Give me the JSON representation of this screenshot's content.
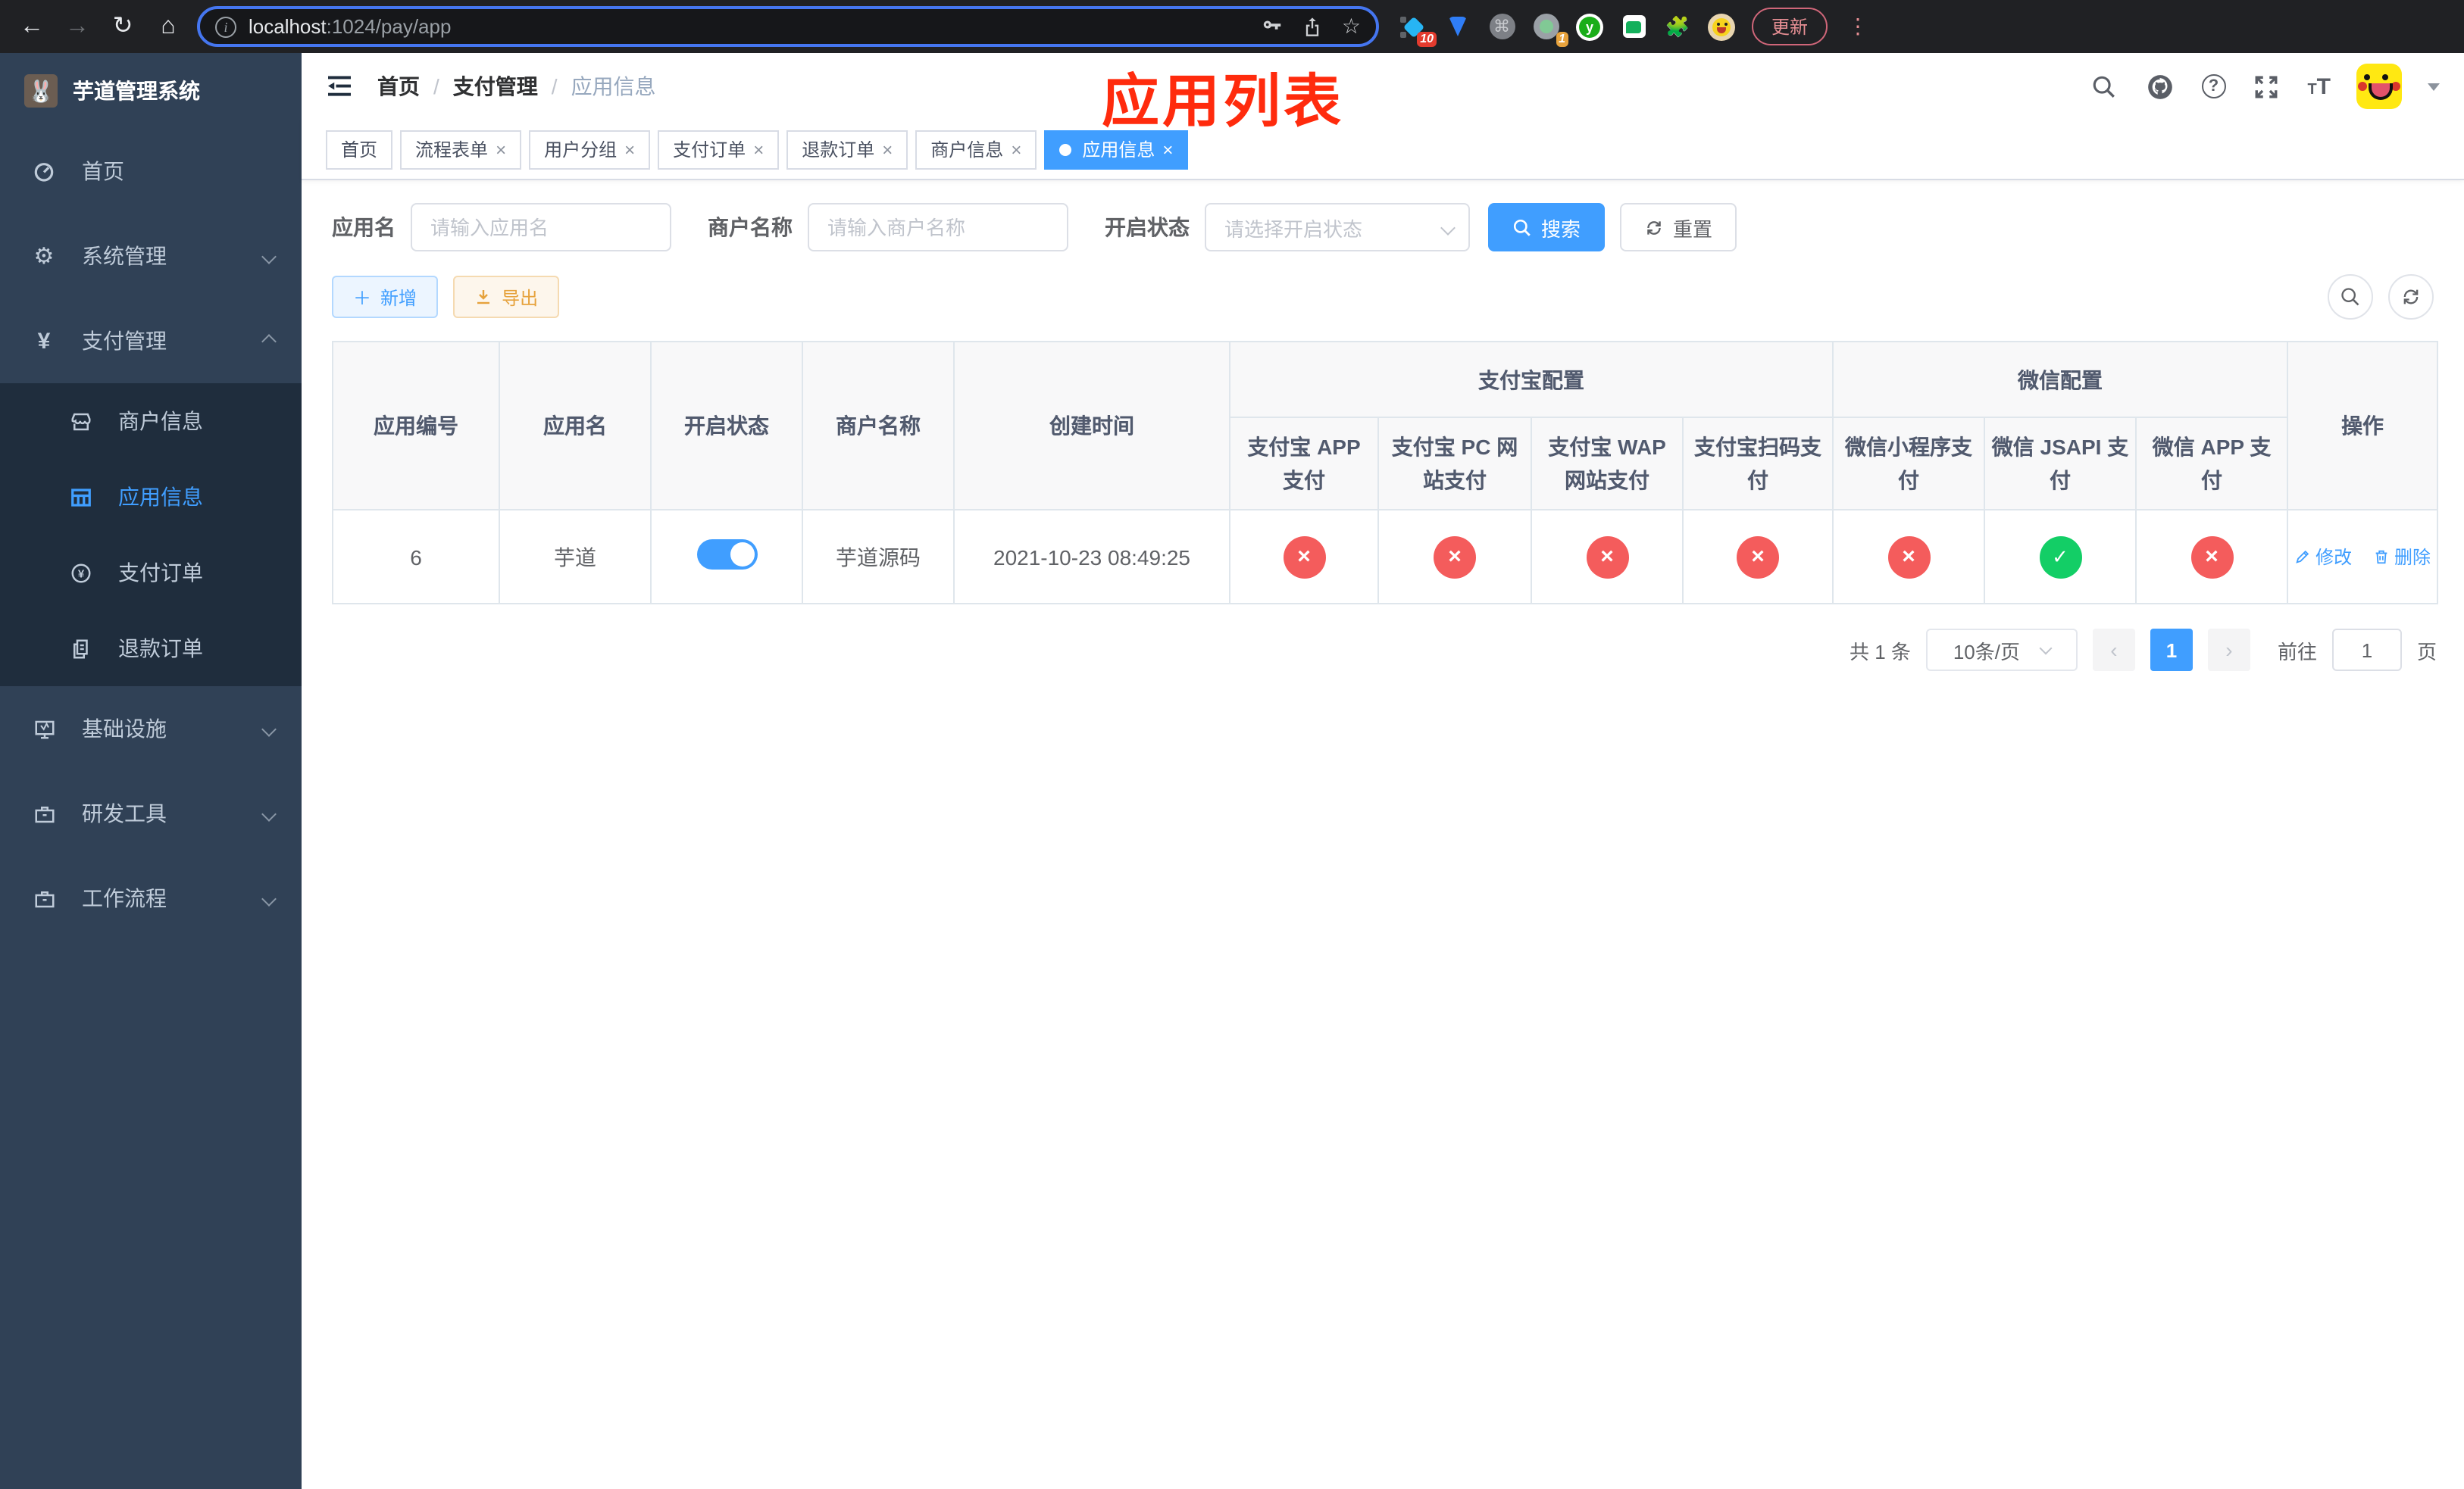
{
  "browser": {
    "url_host": "localhost",
    "url_path": ":1024/pay/app",
    "update_label": "更新",
    "ext_badge_red": "10",
    "ext_badge_orange": "1"
  },
  "sidebar": {
    "title": "芋道管理系统",
    "menu": [
      {
        "label": "首页"
      },
      {
        "label": "系统管理"
      },
      {
        "label": "支付管理"
      },
      {
        "label": "基础设施"
      },
      {
        "label": "研发工具"
      },
      {
        "label": "工作流程"
      }
    ],
    "submenu": [
      {
        "label": "商户信息"
      },
      {
        "label": "应用信息"
      },
      {
        "label": "支付订单"
      },
      {
        "label": "退款订单"
      }
    ]
  },
  "header": {
    "breadcrumb": [
      {
        "label": "首页"
      },
      {
        "label": "支付管理"
      },
      {
        "label": "应用信息"
      }
    ],
    "annotation": "应用列表"
  },
  "tabs": [
    {
      "label": "首页"
    },
    {
      "label": "流程表单"
    },
    {
      "label": "用户分组"
    },
    {
      "label": "支付订单"
    },
    {
      "label": "退款订单"
    },
    {
      "label": "商户信息"
    },
    {
      "label": "应用信息"
    }
  ],
  "filters": {
    "app_name_label": "应用名",
    "app_name_placeholder": "请输入应用名",
    "merchant_label": "商户名称",
    "merchant_placeholder": "请输入商户名称",
    "status_label": "开启状态",
    "status_placeholder": "请选择开启状态",
    "search_label": "搜索",
    "reset_label": "重置"
  },
  "toolbar": {
    "add_label": "新增",
    "export_label": "导出"
  },
  "table": {
    "headers": {
      "app_id": "应用编号",
      "app_name": "应用名",
      "status": "开启状态",
      "merchant": "商户名称",
      "created": "创建时间",
      "alipay_group": "支付宝配置",
      "wechat_group": "微信配置",
      "alipay_app": "支付宝 APP 支付",
      "alipay_pc": "支付宝 PC 网站支付",
      "alipay_wap": "支付宝 WAP 网站支付",
      "alipay_qr": "支付宝扫码支付",
      "wx_lite": "微信小程序支付",
      "wx_jsapi": "微信 JSAPI 支付",
      "wx_app": "微信 APP 支付",
      "actions": "操作"
    },
    "rows": [
      {
        "app_id": "6",
        "app_name": "芋道",
        "status_on": true,
        "merchant": "芋道源码",
        "created": "2021-10-23 08:49:25",
        "channels": {
          "alipay_app": false,
          "alipay_pc": false,
          "alipay_wap": false,
          "alipay_qr": false,
          "wx_lite": false,
          "wx_jsapi": true,
          "wx_app": false
        },
        "edit_label": "修改",
        "delete_label": "删除"
      }
    ]
  },
  "pagination": {
    "total": "共 1 条",
    "page_size": "10条/页",
    "current_page": "1",
    "goto_label": "前往",
    "goto_value": "1",
    "page_unit": "页"
  },
  "colors": {
    "primary": "#409eff",
    "success": "#13ce66",
    "danger": "#f45c5c",
    "sidebar_bg": "#304156",
    "submenu_bg": "#1f2d3d",
    "annotation_red": "#ff2b0d"
  }
}
